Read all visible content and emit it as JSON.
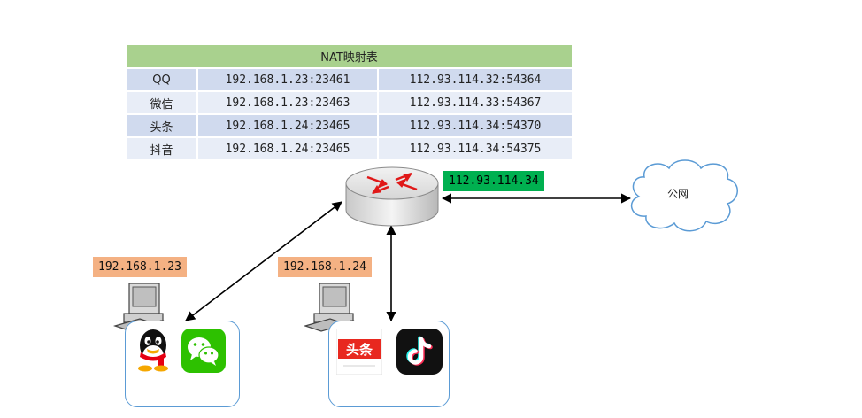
{
  "nat_table": {
    "title": "NAT映射表",
    "rows": [
      {
        "app": "QQ",
        "private": "192.168.1.23:23461",
        "public": "112.93.114.32:54364"
      },
      {
        "app": "微信",
        "private": "192.168.1.23:23463",
        "public": "112.93.114.33:54367"
      },
      {
        "app": "头条",
        "private": "192.168.1.24:23465",
        "public": "112.93.114.34:54370"
      },
      {
        "app": "抖音",
        "private": "192.168.1.24:23465",
        "public": "112.93.114.34:54375"
      }
    ]
  },
  "router": {
    "public_ip": "112.93.114.34"
  },
  "internet": {
    "label": "公网"
  },
  "hosts": [
    {
      "ip": "192.168.1.23",
      "apps": [
        "qq-icon",
        "wechat-icon"
      ]
    },
    {
      "ip": "192.168.1.24",
      "apps": [
        "toutiao-icon",
        "douyin-icon"
      ]
    }
  ],
  "apps": {
    "toutiao_text": "头条"
  },
  "colors": {
    "table_header": "#a9d18e",
    "row_dark": "#d0daee",
    "row_light": "#e8edf7",
    "ip_private": "#f4b183",
    "ip_public": "#00b050",
    "box_border": "#5b9bd5"
  }
}
